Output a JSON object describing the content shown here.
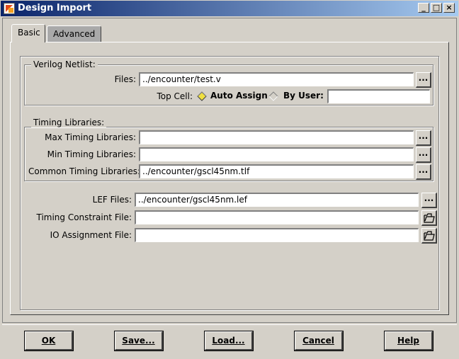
{
  "window": {
    "title": "Design Import",
    "controls": [
      "_",
      "□",
      "×"
    ]
  },
  "tabs": [
    {
      "label": "Basic",
      "selected": true
    },
    {
      "label": "Advanced",
      "selected": false
    }
  ],
  "verilog": {
    "legend": "Verilog Netlist:",
    "files_label": "Files:",
    "files_value": "../encounter/test.v",
    "browse": "...",
    "top_cell_label": "Top Cell:",
    "auto_assign": "Auto Assign",
    "by_user": "By User:",
    "top_cell_selected": "Auto Assign",
    "by_user_value": ""
  },
  "timing": {
    "legend": "Timing Libraries:",
    "max_label": "Max Timing Libraries:",
    "max_value": "",
    "min_label": "Min Timing Libraries:",
    "min_value": "",
    "common_label": "Common Timing Libraries:",
    "common_value": "../encounter/gscl45nm.tlf",
    "browse": "..."
  },
  "other": {
    "lef_label": "LEF Files:",
    "lef_value": "../encounter/gscl45nm.lef",
    "browse": "...",
    "timing_constraint_label": "Timing Constraint File:",
    "timing_constraint_value": "",
    "io_label": "IO Assignment File:",
    "io_value": ""
  },
  "buttons": {
    "ok": "OK",
    "save": "Save...",
    "load": "Load...",
    "cancel": "Cancel",
    "help": "Help"
  },
  "icons": {
    "app": "design-import-app-icon",
    "folder": "folder-open-icon"
  }
}
